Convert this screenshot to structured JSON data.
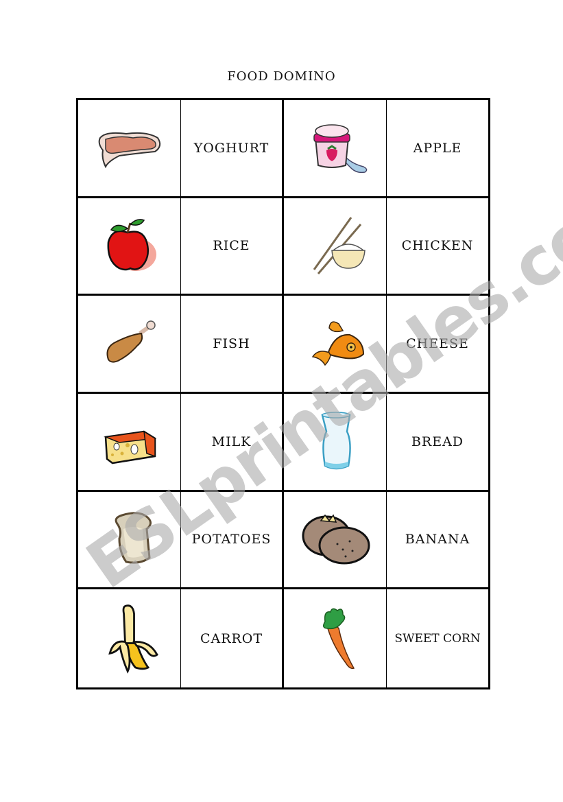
{
  "title": "FOOD DOMINO",
  "watermark": "ESLprintables.com",
  "rows": [
    {
      "left_image": "meat-steak",
      "left_word": "YOGHURT",
      "right_image": "yoghurt",
      "right_word": "APPLE"
    },
    {
      "left_image": "apple",
      "left_word": "RICE",
      "right_image": "rice-bowl-chopsticks",
      "right_word": "CHICKEN"
    },
    {
      "left_image": "chicken-leg",
      "left_word": "FISH",
      "right_image": "fish",
      "right_word": "CHEESE"
    },
    {
      "left_image": "cheese",
      "left_word": "MILK",
      "right_image": "milk-glass",
      "right_word": "BREAD"
    },
    {
      "left_image": "bread-slice",
      "left_word": "POTATOES",
      "right_image": "potatoes",
      "right_word": "BANANA"
    },
    {
      "left_image": "banana",
      "left_word": "CARROT",
      "right_image": "carrot",
      "right_word": "SWEET CORN"
    }
  ]
}
